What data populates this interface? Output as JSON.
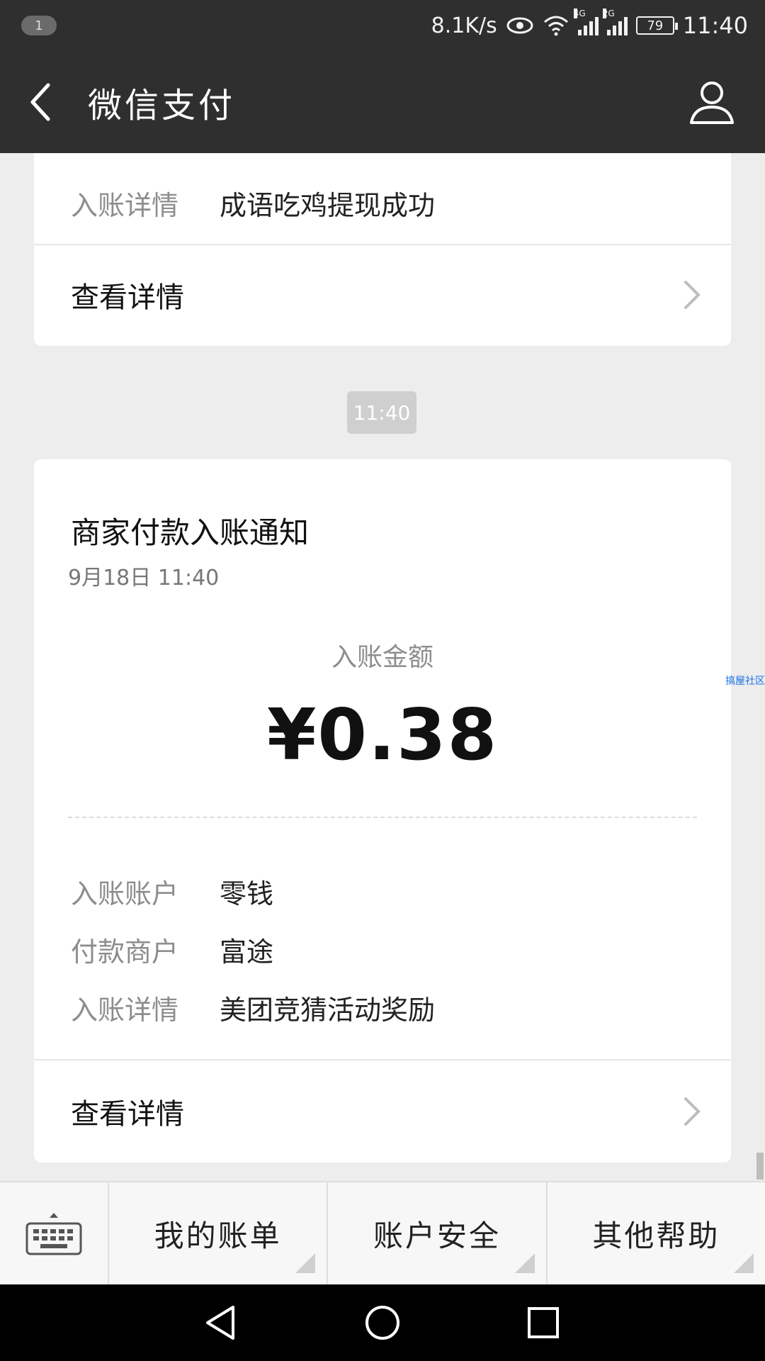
{
  "status_bar": {
    "notification_count": "1",
    "net_speed": "8.1K/s",
    "battery": "79",
    "time": "11:40",
    "signal_tags": [
      "4G",
      "2G"
    ],
    "icons": [
      "eye-icon",
      "wifi-icon",
      "signal-icon",
      "battery-icon"
    ]
  },
  "header": {
    "title": "微信支付",
    "back_icon": "back-arrow-icon",
    "profile_icon": "profile-icon"
  },
  "previous_message": {
    "detail_key": "入账详情",
    "detail_value": "成语吃鸡提现成功",
    "view_label": "查看详情"
  },
  "timestamp": "11:40",
  "message": {
    "title": "商家付款入账通知",
    "date": "9月18日  11:40",
    "amount_label": "入账金额",
    "amount": "¥0.38",
    "rows": [
      {
        "key": "入账账户",
        "value": "零钱"
      },
      {
        "key": "付款商户",
        "value": "富途"
      },
      {
        "key": "入账详情",
        "value": "美团竞猜活动奖励"
      }
    ],
    "view_label": "查看详情"
  },
  "watermark": "搞屋社区",
  "menu": {
    "items": [
      "我的账单",
      "账户安全",
      "其他帮助"
    ],
    "keyboard_icon": "keyboard-icon"
  },
  "colors": {
    "header_bg": "#2f2f2f",
    "page_bg": "#ededed",
    "card_bg": "#ffffff"
  }
}
